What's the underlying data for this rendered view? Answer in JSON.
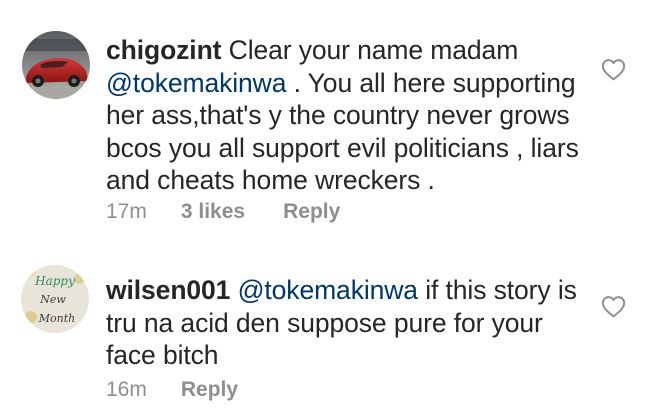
{
  "comments": [
    {
      "username": "chigozint",
      "text_before": " Clear your name madam ",
      "mention": "@tokemakinwa",
      "text_after": " . You all here supporting her ass,that's y the country never grows bcos you all support evil politicians , liars and cheats home wreckers .",
      "time": "17m",
      "likes": "3 likes",
      "reply_label": "Reply",
      "avatar_icon": "red-car-avatar-icon",
      "like_icon": "heart-outline-icon"
    },
    {
      "username": "wilsen001",
      "text_before": " ",
      "mention": "@tokemakinwa",
      "text_after": " if this story is tru na acid den suppose pure for your face bitch",
      "time": "16m",
      "reply_label": "Reply",
      "avatar_icon": "happy-new-month-avatar-icon",
      "avatar_text": [
        "Happy",
        "New",
        "Month"
      ],
      "like_icon": "heart-outline-icon"
    }
  ],
  "colors": {
    "text": "#262626",
    "meta": "#8e8e8e",
    "mention": "#00376b",
    "background": "#ffffff"
  }
}
